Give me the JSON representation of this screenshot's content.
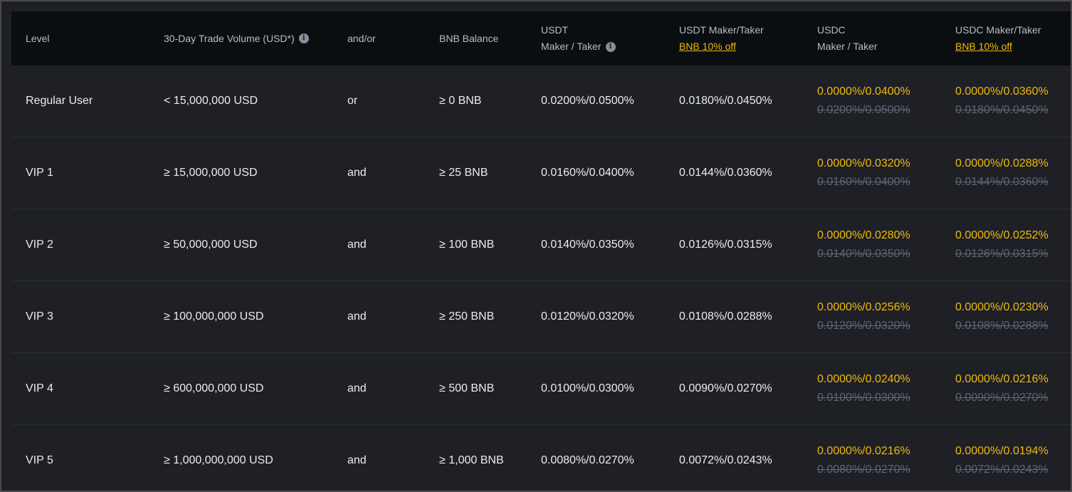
{
  "header": {
    "level": "Level",
    "volume": "30-Day Trade Volume (USD*)",
    "andor": "and/or",
    "bnb_balance": "BNB Balance",
    "usdt_line1": "USDT",
    "usdt_line2": "Maker / Taker",
    "usdt_bnb_line1": "USDT Maker/Taker",
    "usdt_bnb_link": "BNB 10% off",
    "usdc_line1": "USDC",
    "usdc_line2": "Maker / Taker",
    "usdc_bnb_line1": "USDC Maker/Taker",
    "usdc_bnb_link": "BNB 10% off"
  },
  "rows": [
    {
      "level": "Regular User",
      "volume": "< 15,000,000 USD",
      "andor": "or",
      "bnb": "≥ 0 BNB",
      "usdt": "0.0200%/0.0500%",
      "usdt_bnb": "0.0180%/0.0450%",
      "usdc_promo": "0.0000%/0.0400%",
      "usdc_orig": "0.0200%/0.0500%",
      "usdc_bnb_promo": "0.0000%/0.0360%",
      "usdc_bnb_orig": "0.0180%/0.0450%"
    },
    {
      "level": "VIP 1",
      "volume": "≥ 15,000,000 USD",
      "andor": "and",
      "bnb": "≥ 25 BNB",
      "usdt": "0.0160%/0.0400%",
      "usdt_bnb": "0.0144%/0.0360%",
      "usdc_promo": "0.0000%/0.0320%",
      "usdc_orig": "0.0160%/0.0400%",
      "usdc_bnb_promo": "0.0000%/0.0288%",
      "usdc_bnb_orig": "0.0144%/0.0360%"
    },
    {
      "level": "VIP 2",
      "volume": "≥ 50,000,000 USD",
      "andor": "and",
      "bnb": "≥ 100 BNB",
      "usdt": "0.0140%/0.0350%",
      "usdt_bnb": "0.0126%/0.0315%",
      "usdc_promo": "0.0000%/0.0280%",
      "usdc_orig": "0.0140%/0.0350%",
      "usdc_bnb_promo": "0.0000%/0.0252%",
      "usdc_bnb_orig": "0.0126%/0.0315%"
    },
    {
      "level": "VIP 3",
      "volume": "≥ 100,000,000 USD",
      "andor": "and",
      "bnb": "≥ 250 BNB",
      "usdt": "0.0120%/0.0320%",
      "usdt_bnb": "0.0108%/0.0288%",
      "usdc_promo": "0.0000%/0.0256%",
      "usdc_orig": "0.0120%/0.0320%",
      "usdc_bnb_promo": "0.0000%/0.0230%",
      "usdc_bnb_orig": "0.0108%/0.0288%"
    },
    {
      "level": "VIP 4",
      "volume": "≥ 600,000,000 USD",
      "andor": "and",
      "bnb": "≥ 500 BNB",
      "usdt": "0.0100%/0.0300%",
      "usdt_bnb": "0.0090%/0.0270%",
      "usdc_promo": "0.0000%/0.0240%",
      "usdc_orig": "0.0100%/0.0300%",
      "usdc_bnb_promo": "0.0000%/0.0216%",
      "usdc_bnb_orig": "0.0090%/0.0270%"
    },
    {
      "level": "VIP 5",
      "volume": "≥ 1,000,000,000 USD",
      "andor": "and",
      "bnb": "≥ 1,000 BNB",
      "usdt": "0.0080%/0.0270%",
      "usdt_bnb": "0.0072%/0.0243%",
      "usdc_promo": "0.0000%/0.0216%",
      "usdc_orig": "0.0080%/0.0270%",
      "usdc_bnb_promo": "0.0000%/0.0194%",
      "usdc_bnb_orig": "0.0072%/0.0243%"
    }
  ],
  "icons": {
    "info": "info-icon"
  },
  "colors": {
    "background": "#1e2026",
    "header_background": "#0b0e11",
    "accent": "#f0b90b",
    "muted": "#5e6673",
    "text": "#eaecef"
  }
}
